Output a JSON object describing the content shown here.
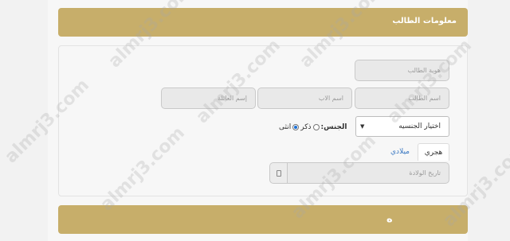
{
  "student_info": {
    "title": "معلومات الطالب",
    "id_placeholder": "هوية الطالب",
    "name_placeholder": "اسم الطالب",
    "father_placeholder": "اسم الاب",
    "family_placeholder": "إسم العائلة",
    "gender_select": "اختيار الجنسيه",
    "gender_label": "الجنس:",
    "male_label": "ذكر",
    "female_label": "انثى",
    "tab_hijri": "هجري",
    "tab_gregorian": "ميلادي",
    "dob_placeholder": "تاريخ الولادة"
  },
  "next_section": {
    "title_fragment": "ه"
  },
  "watermark": "almrj3.com",
  "colors": {
    "header": "#c7ae6a",
    "link": "#3a78c2"
  }
}
